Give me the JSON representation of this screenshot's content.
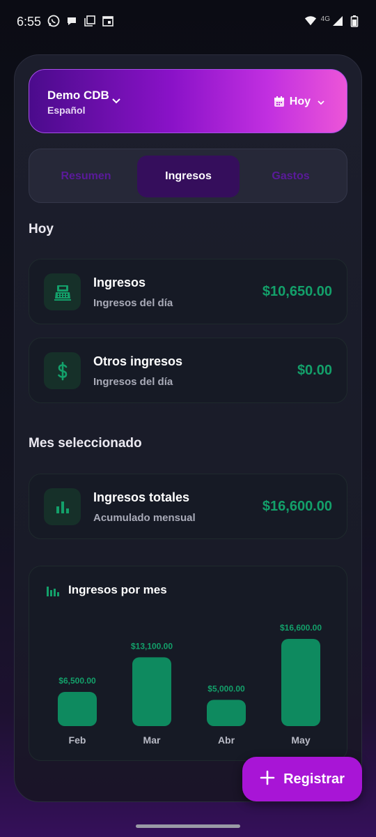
{
  "status_bar": {
    "time": "6:55",
    "network": "4G"
  },
  "header": {
    "org_name": "Demo CDB",
    "language": "Español",
    "date_filter": "Hoy"
  },
  "tabs": [
    {
      "label": "Resumen",
      "active": false
    },
    {
      "label": "Ingresos",
      "active": true
    },
    {
      "label": "Gastos",
      "active": false
    }
  ],
  "today": {
    "title": "Hoy",
    "cards": [
      {
        "icon": "cash-register-icon",
        "title": "Ingresos",
        "subtitle": "Ingresos del día",
        "value": "$10,650.00"
      },
      {
        "icon": "dollar-icon",
        "title": "Otros ingresos",
        "subtitle": "Ingresos del día",
        "value": "$0.00"
      }
    ]
  },
  "month": {
    "title": "Mes seleccionado",
    "card": {
      "icon": "bar-chart-icon",
      "title": "Ingresos totales",
      "subtitle": "Acumulado mensual",
      "value": "$16,600.00"
    }
  },
  "chart": {
    "title": "Ingresos por mes",
    "bar_color": "#0e8a5f",
    "label_color": "#13a06a"
  },
  "chart_data": {
    "type": "bar",
    "title": "Ingresos por mes",
    "categories": [
      "Feb",
      "Mar",
      "Abr",
      "May"
    ],
    "values": [
      6500,
      13100,
      5000,
      16600
    ],
    "value_labels": [
      "$6,500.00",
      "$13,100.00",
      "$5,000.00",
      "$16,600.00"
    ],
    "grid": false,
    "xlabel": "",
    "ylabel": ""
  },
  "fab": {
    "label": "Registrar"
  },
  "colors": {
    "accent": "#a815d6",
    "money": "#13a06a"
  }
}
